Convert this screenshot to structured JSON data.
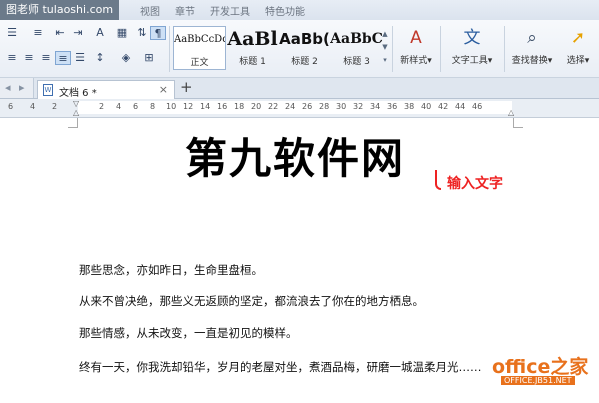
{
  "watermark_top": "图老师 tulaoshi.com",
  "top_menu": [
    "视图",
    "章节",
    "开发工具",
    "特色功能"
  ],
  "styles": [
    {
      "sample": "AaBbCcDd",
      "name": "正文"
    },
    {
      "sample": "AaBl",
      "name": "标题 1"
    },
    {
      "sample": "AaBb(",
      "name": "标题 2"
    },
    {
      "sample": "AaBbC",
      "name": "标题 3"
    }
  ],
  "ribbon_buttons": {
    "new_style": "新样式▾",
    "text_tools": "文字工具▾",
    "find_replace": "查找替换▾",
    "select": "选择▾"
  },
  "tab": {
    "label": "文档 6 *",
    "add": "+"
  },
  "ruler_numbers": [
    "6",
    "4",
    "2",
    "2",
    "4",
    "6",
    "8",
    "10",
    "12",
    "14",
    "16",
    "18",
    "20",
    "22",
    "24",
    "26",
    "28",
    "30",
    "32",
    "34",
    "36",
    "38",
    "40",
    "42",
    "44",
    "46"
  ],
  "document": {
    "title": "第九软件网",
    "annotation": "输入文字",
    "paragraphs": [
      "那些思念，亦如昨日，生命里盘桓。",
      "从来不曾决绝，那些义无返顾的坚定，都流浪去了你在的地方栖息。",
      "那些情感，从未改变，一直是初见的模样。",
      "终有一天，你我洗却铅华，岁月的老屋对坐，煮酒品梅，研磨一城温柔月光……"
    ]
  },
  "watermark_bottom": {
    "main": "office之家",
    "sub": "OFFICE.JB51.NET"
  },
  "colors": {
    "accent_red": "#e22222",
    "watermark_orange": "#e8711c",
    "ribbon_bg": "#eef2f7"
  }
}
